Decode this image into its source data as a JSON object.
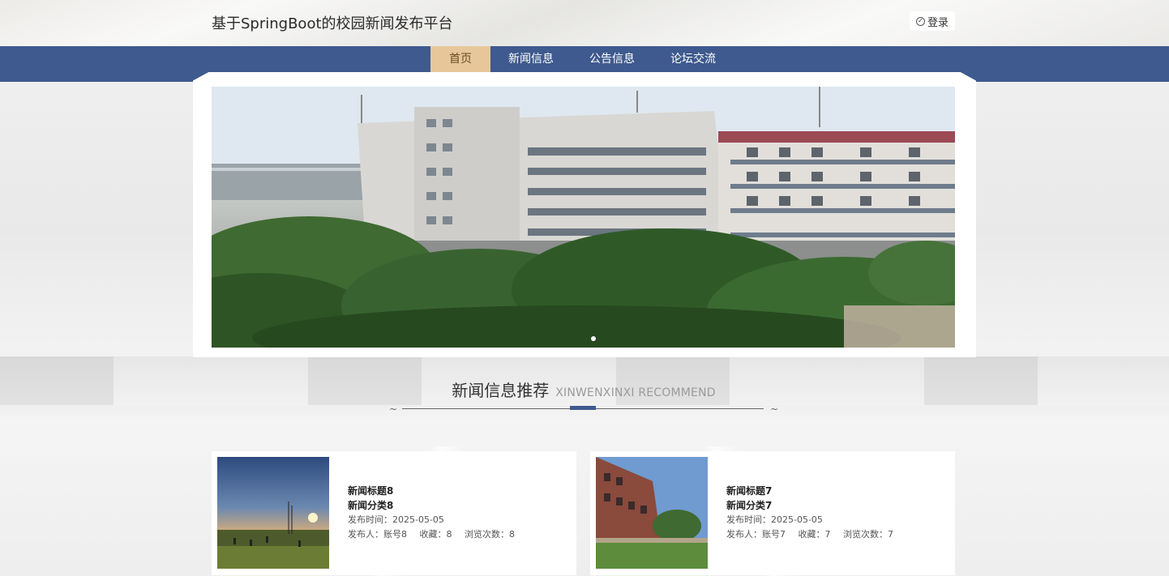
{
  "header": {
    "site_title": "基于SpringBoot的校园新闻发布平台",
    "login_label": "登录"
  },
  "nav": {
    "items": [
      {
        "label": "首页",
        "active": true
      },
      {
        "label": "新闻信息",
        "active": false
      },
      {
        "label": "公告信息",
        "active": false
      },
      {
        "label": "论坛交流",
        "active": false
      }
    ]
  },
  "carousel": {
    "slide_count": 1,
    "active_index": 0
  },
  "section": {
    "title": "新闻信息推荐",
    "subtitle": "XINWENXINXI RECOMMEND"
  },
  "news": [
    {
      "title": "新闻标题8",
      "category": "新闻分类8",
      "publish_time_label": "发布时间：",
      "publish_time": "2025-05-05",
      "publisher_label": "发布人：",
      "publisher": "账号8",
      "favorites_label": "收藏：",
      "favorites": "8",
      "views_label": "浏览次数：",
      "views": "8"
    },
    {
      "title": "新闻标题7",
      "category": "新闻分类7",
      "publish_time_label": "发布时间：",
      "publish_time": "2025-05-05",
      "publisher_label": "发布人：",
      "publisher": "账号7",
      "favorites_label": "收藏：",
      "favorites": "7",
      "views_label": "浏览次数：",
      "views": "7"
    }
  ],
  "colors": {
    "nav_bg": "#3e5a8e",
    "nav_active_bg": "#e7c79a",
    "accent": "#3e5a8e"
  }
}
